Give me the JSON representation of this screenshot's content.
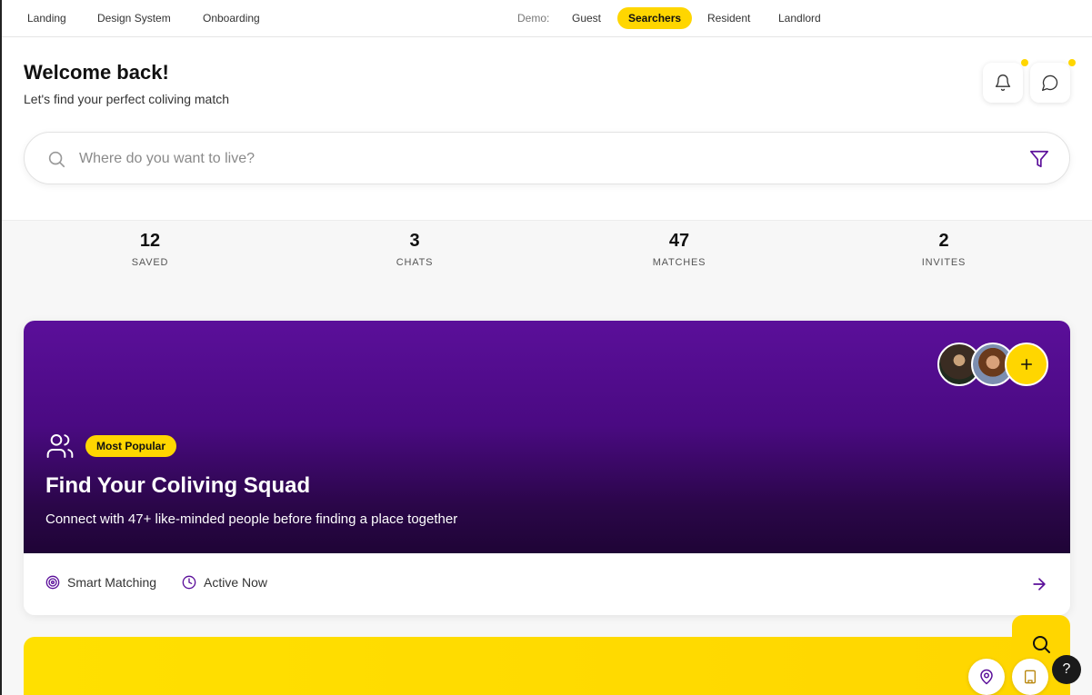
{
  "topnav": {
    "links": [
      "Landing",
      "Design System",
      "Onboarding"
    ],
    "demo_label": "Demo:",
    "demo_modes": [
      "Guest",
      "Searchers",
      "Resident",
      "Landlord"
    ],
    "active_mode": "Searchers"
  },
  "header": {
    "title": "Welcome back!",
    "subtitle": "Let's find your perfect coliving match",
    "icons": [
      "bell-icon",
      "message-icon"
    ]
  },
  "search": {
    "placeholder": "Where do you want to live?",
    "value": ""
  },
  "stats": [
    {
      "value": "12",
      "label": "SAVED"
    },
    {
      "value": "3",
      "label": "CHATS"
    },
    {
      "value": "47",
      "label": "MATCHES"
    },
    {
      "value": "2",
      "label": "INVITES"
    }
  ],
  "squad_card": {
    "badge": "Most Popular",
    "title": "Find Your Coliving Squad",
    "description": "Connect with 47+ like-minded people before finding a place together",
    "features": [
      "Smart Matching",
      "Active Now"
    ]
  },
  "help": {
    "label": "?"
  },
  "colors": {
    "accent": "#FFD600",
    "purple": "#5b0f9a",
    "purple_dark": "#1f0436"
  }
}
